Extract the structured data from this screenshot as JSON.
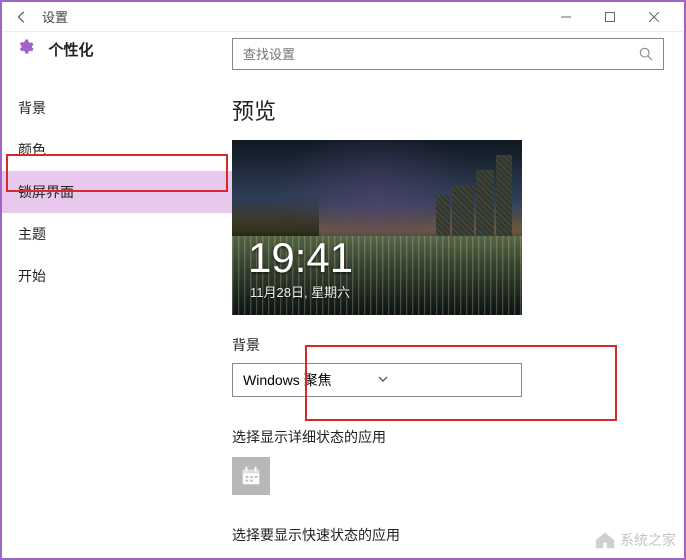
{
  "titlebar": {
    "title": "设置"
  },
  "category": "个性化",
  "search": {
    "placeholder": "查找设置"
  },
  "nav": {
    "items": [
      {
        "label": "背景"
      },
      {
        "label": "颜色"
      },
      {
        "label": "锁屏界面"
      },
      {
        "label": "主题"
      },
      {
        "label": "开始"
      }
    ]
  },
  "main": {
    "preview_title": "预览",
    "lock_time": "19:41",
    "lock_date": "11月28日, 星期六",
    "bg_label": "背景",
    "bg_value": "Windows 聚焦",
    "detail_label": "选择显示详细状态的应用",
    "quick_label": "选择要显示快速状态的应用"
  },
  "watermark": "系统之家"
}
